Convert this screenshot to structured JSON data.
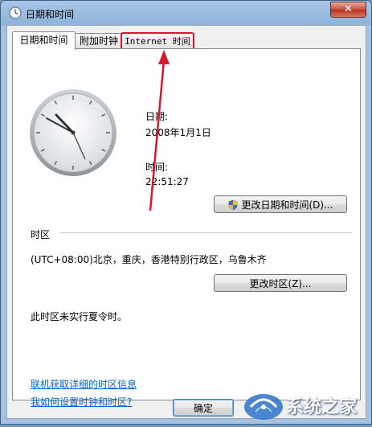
{
  "window": {
    "title": "日期和时间",
    "close_symbol": "✕"
  },
  "tabs": [
    {
      "label": "日期和时间"
    },
    {
      "label": "附加时钟"
    },
    {
      "label": "Internet 时间"
    }
  ],
  "datetime": {
    "date_label": "日期:",
    "date_value": "2008年1月1日",
    "time_label": "时间:",
    "time_value": "22:51:27",
    "change_button": "更改日期和时间(D)..."
  },
  "timezone": {
    "group_label": "时区",
    "value": "(UTC+08:00)北京，重庆，香港特别行政区，乌鲁木齐",
    "change_button": "更改时区(Z)...",
    "dst_note": "此时区未实行夏令时。"
  },
  "links": {
    "online_info": "联机获取详细的时区信息",
    "how_to": "我如何设置时钟和时区?"
  },
  "footer": {
    "ok_button": "确定"
  },
  "watermark": {
    "text": "系统之家"
  },
  "colors": {
    "annotation_red": "#d7172e",
    "link_blue": "#0066cc"
  }
}
